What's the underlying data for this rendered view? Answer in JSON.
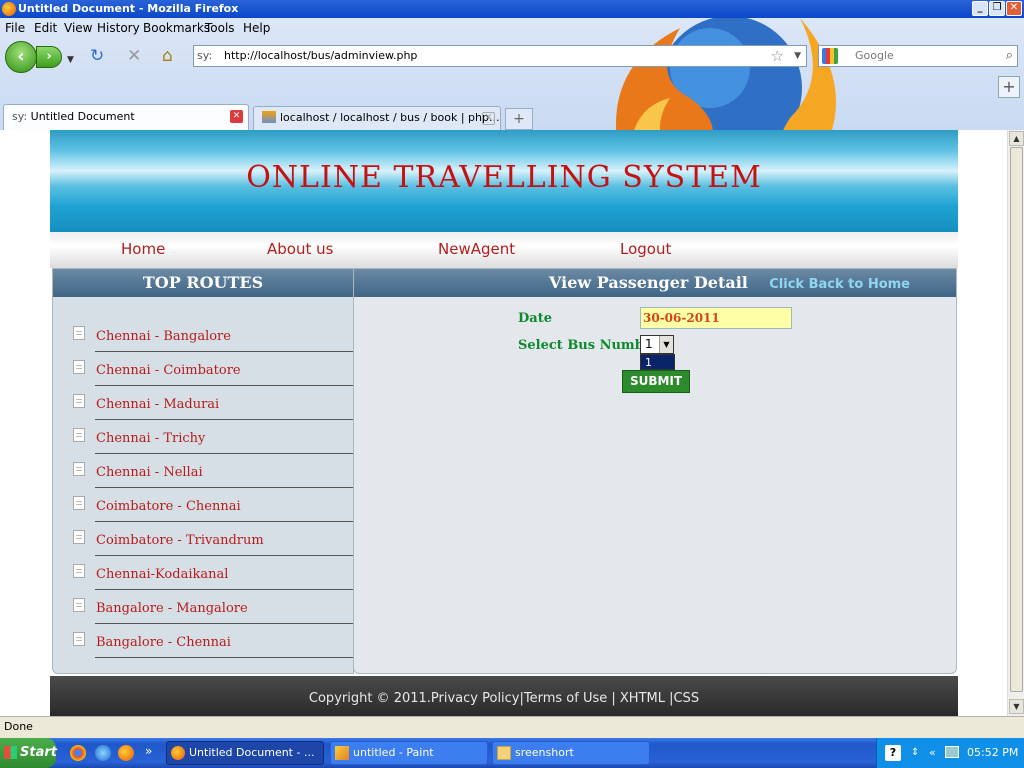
{
  "window": {
    "title": "Untitled Document - Mozilla Firefox"
  },
  "menu": [
    "File",
    "Edit",
    "View",
    "History",
    "Bookmarks",
    "Tools",
    "Help"
  ],
  "address": {
    "prefix": "sy:",
    "url": "http://localhost/bus/adminview.php"
  },
  "search": {
    "placeholder": "Google"
  },
  "tabs": [
    {
      "label": "Untitled Document",
      "prefix": "sy:",
      "active": true
    },
    {
      "label": "localhost / localhost / bus / book | php...",
      "active": false
    }
  ],
  "site": {
    "title": "ONLINE TRAVELLING SYSTEM",
    "nav": [
      "Home",
      "About us",
      "NewAgent",
      "Logout"
    ],
    "sidebar_heading": "TOP ROUTES",
    "routes": [
      "Chennai - Bangalore",
      "Chennai - Coimbatore",
      "Chennai - Madurai",
      "Chennai - Trichy",
      "Chennai - Nellai",
      "Coimbatore - Chennai",
      "Coimbatore - Trivandrum",
      "Chennai-Kodaikanal",
      "Bangalore - Mangalore",
      "Bangalore - Chennai"
    ],
    "main_heading": "View Passenger Detail",
    "back_link": "Click Back to Home",
    "form": {
      "date_label": "Date",
      "date_value": "30-06-2011",
      "bus_label": "Select Bus Number",
      "bus_selected": "1",
      "bus_options": [
        "1"
      ],
      "submit": "SUBMIT"
    },
    "footer": "Copyright © 2011.Privacy Policy|Terms of Use | XHTML |CSS"
  },
  "status": {
    "text": "Done"
  },
  "taskbar": {
    "start": "Start",
    "tasks": [
      "Untitled Document - ...",
      "untitled - Paint",
      "sreenshort"
    ],
    "clock": "05:52 PM"
  },
  "colors": {
    "brand_red": "#c51111",
    "header_blue": "#3f6585",
    "form_green": "#0c8a2e"
  }
}
